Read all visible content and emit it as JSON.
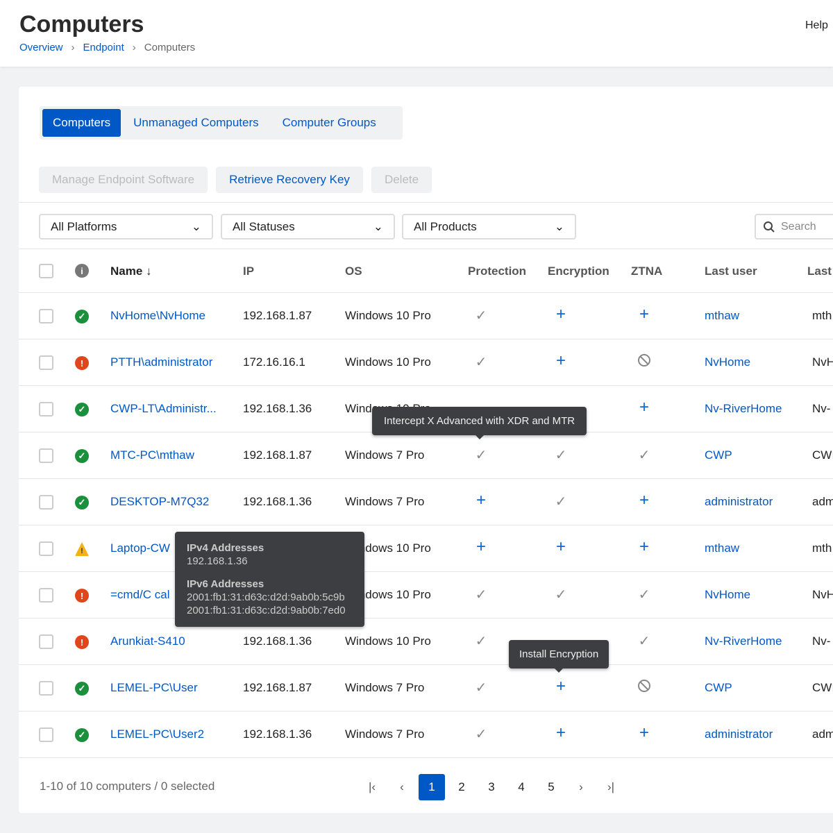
{
  "header": {
    "title": "Computers",
    "help": "Help",
    "breadcrumb": [
      "Overview",
      "Endpoint",
      "Computers"
    ]
  },
  "tabs": [
    {
      "label": "Computers",
      "active": true
    },
    {
      "label": "Unmanaged Computers"
    },
    {
      "label": "Computer Groups"
    }
  ],
  "actions": [
    {
      "label": "Manage Endpoint Software",
      "enabled": false
    },
    {
      "label": "Retrieve Recovery Key",
      "enabled": true
    },
    {
      "label": "Delete",
      "enabled": false
    }
  ],
  "filters": [
    "All Platforms",
    "All Statuses",
    "All Products"
  ],
  "search": {
    "placeholder": "Search"
  },
  "columns": [
    "Name",
    "IP",
    "OS",
    "Protection",
    "Encryption",
    "ZTNA",
    "Last user",
    "Last"
  ],
  "rows": [
    {
      "status": "ok",
      "name": "NvHome\\NvHome",
      "ip": "192.168.1.87",
      "os": "Windows 10 Pro",
      "protection": "check",
      "encryption": "plus",
      "ztna": "plus",
      "last_user": "mthaw",
      "last": "mth"
    },
    {
      "status": "error",
      "name": "PTTH\\administrator",
      "ip": "172.16.16.1",
      "os": "Windows 10 Pro",
      "protection": "check",
      "encryption": "plus",
      "ztna": "blocked",
      "last_user": "NvHome",
      "last": "NvH"
    },
    {
      "status": "ok",
      "name": "CWP-LT\\Administr...",
      "ip": "192.168.1.36",
      "os": "Windows 10 Pro",
      "protection": "",
      "encryption": "",
      "ztna": "plus",
      "last_user": "Nv-RiverHome",
      "last": "Nv-"
    },
    {
      "status": "ok",
      "name": "MTC-PC\\mthaw",
      "ip": "192.168.1.87",
      "os": "Windows 7 Pro",
      "protection": "check",
      "encryption": "check",
      "ztna": "check",
      "last_user": "CWP",
      "last": "CWI"
    },
    {
      "status": "ok",
      "name": "DESKTOP-M7Q32",
      "ip": "192.168.1.36",
      "os": "Windows 7 Pro",
      "protection": "plus",
      "encryption": "check",
      "ztna": "plus",
      "last_user": "administrator",
      "last": "adm"
    },
    {
      "status": "warning",
      "name": "Laptop-CW",
      "ip": "",
      "os": "Windows 10 Pro",
      "protection": "plus",
      "encryption": "plus",
      "ztna": "plus",
      "last_user": "mthaw",
      "last": "mth"
    },
    {
      "status": "error",
      "name": "=cmd/C cal",
      "ip": "",
      "os": "Windows 10 Pro",
      "protection": "check",
      "encryption": "check",
      "ztna": "check",
      "last_user": "NvHome",
      "last": "NvH"
    },
    {
      "status": "error",
      "name": "Arunkiat-S410",
      "ip": "192.168.1.36",
      "os": "Windows 10 Pro",
      "protection": "check",
      "encryption": "",
      "ztna": "check",
      "last_user": "Nv-RiverHome",
      "last": "Nv-"
    },
    {
      "status": "ok",
      "name": "LEMEL-PC\\User",
      "ip": "192.168.1.87",
      "os": "Windows 7 Pro",
      "protection": "check",
      "encryption": "plus",
      "ztna": "blocked",
      "last_user": "CWP",
      "last": "CWI"
    },
    {
      "status": "ok",
      "name": "LEMEL-PC\\User2",
      "ip": "192.168.1.36",
      "os": "Windows 7 Pro",
      "protection": "check",
      "encryption": "plus",
      "ztna": "plus",
      "last_user": "administrator",
      "last": "adm"
    }
  ],
  "tooltips": {
    "protection": "Intercept X Advanced with XDR and MTR",
    "ip": {
      "ipv4_label": "IPv4 Addresses",
      "ipv4": [
        "192.168.1.36"
      ],
      "ipv6_label": "IPv6 Addresses",
      "ipv6": [
        "2001:fb1:31:d63c:d2d:9ab0b:5c9b",
        "2001:fb1:31:d63c:d2d:9ab0b:7ed0"
      ]
    },
    "encryption": "Install Encryption"
  },
  "footer": {
    "summary": "1-10 of 10 computers / 0 selected",
    "pages": [
      "1",
      "2",
      "3",
      "4",
      "5"
    ],
    "current_page": "1"
  },
  "colors": {
    "accent": "#0058c7",
    "ok": "#1a8f3c",
    "error": "#e0461c",
    "warning": "#f5b214"
  }
}
